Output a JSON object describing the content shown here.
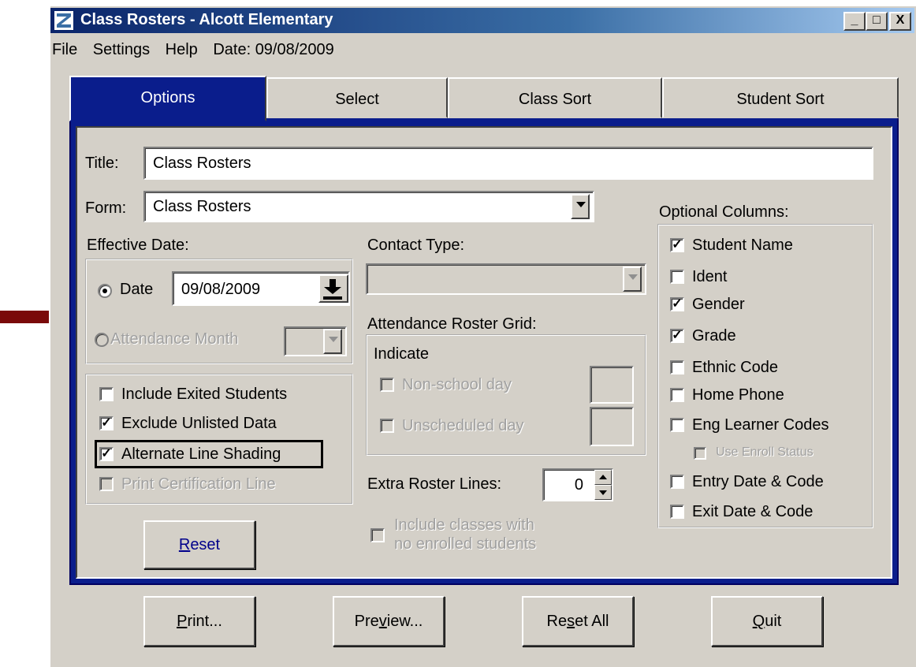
{
  "window": {
    "title": "Class Rosters - Alcott Elementary",
    "controls": [
      "_",
      "□",
      "X"
    ]
  },
  "menu": {
    "file": "File",
    "settings": "Settings",
    "help": "Help",
    "date": "Date: 09/08/2009"
  },
  "tabs": [
    "Options",
    "Select",
    "Class Sort",
    "Student Sort"
  ],
  "form": {
    "title_label": "Title:",
    "title_value": "Class Rosters",
    "form_label": "Form:",
    "form_value": "Class Rosters",
    "effective_date_label": "Effective Date:",
    "date_radio_label": "Date",
    "date_value": "09/08/2009",
    "attendance_month_label": "Attendance Month",
    "contact_type_label": "Contact Type:",
    "attendance_grid_label": "Attendance Roster Grid:",
    "indicate_label": "Indicate",
    "non_school_day": "Non-school day",
    "unscheduled_day": "Unscheduled day",
    "extra_lines_label": "Extra Roster Lines:",
    "extra_lines_value": "0",
    "include_classes_line1": "Include classes with",
    "include_classes_line2": "no enrolled students"
  },
  "options_checks": [
    {
      "label": "Include Exited Students",
      "checked": false
    },
    {
      "label": "Exclude Unlisted Data",
      "checked": true
    },
    {
      "label": "Alternate Line Shading",
      "checked": true
    },
    {
      "label": "Print Certification Line",
      "checked": false
    }
  ],
  "optional_columns": {
    "label": "Optional Columns:",
    "items": [
      {
        "label": "Student Name",
        "checked": true
      },
      {
        "label": "Ident",
        "checked": false
      },
      {
        "label": "Gender",
        "checked": true
      },
      {
        "label": "Grade",
        "checked": true
      },
      {
        "label": "Ethnic Code",
        "checked": false
      },
      {
        "label": "Home Phone",
        "checked": false
      },
      {
        "label": "Eng Learner Codes",
        "checked": false
      },
      {
        "label": "Use Enroll Status",
        "checked": false
      },
      {
        "label": "Entry Date & Code",
        "checked": false
      },
      {
        "label": "Exit Date & Code",
        "checked": false
      }
    ]
  },
  "buttons": {
    "reset": {
      "hot": "R",
      "rest": "eset"
    },
    "print": {
      "hot": "P",
      "rest": "rint..."
    },
    "preview": {
      "pre": "Pre",
      "hot": "v",
      "rest": "iew..."
    },
    "reset_all": {
      "pre": "Re",
      "hot": "s",
      "rest": "et All"
    },
    "quit": {
      "hot": "Q",
      "rest": "uit"
    }
  },
  "colors": {
    "arrow": "#7a0a0a",
    "tab_active": "#0a1d8c",
    "face": "#d4d0c8"
  }
}
